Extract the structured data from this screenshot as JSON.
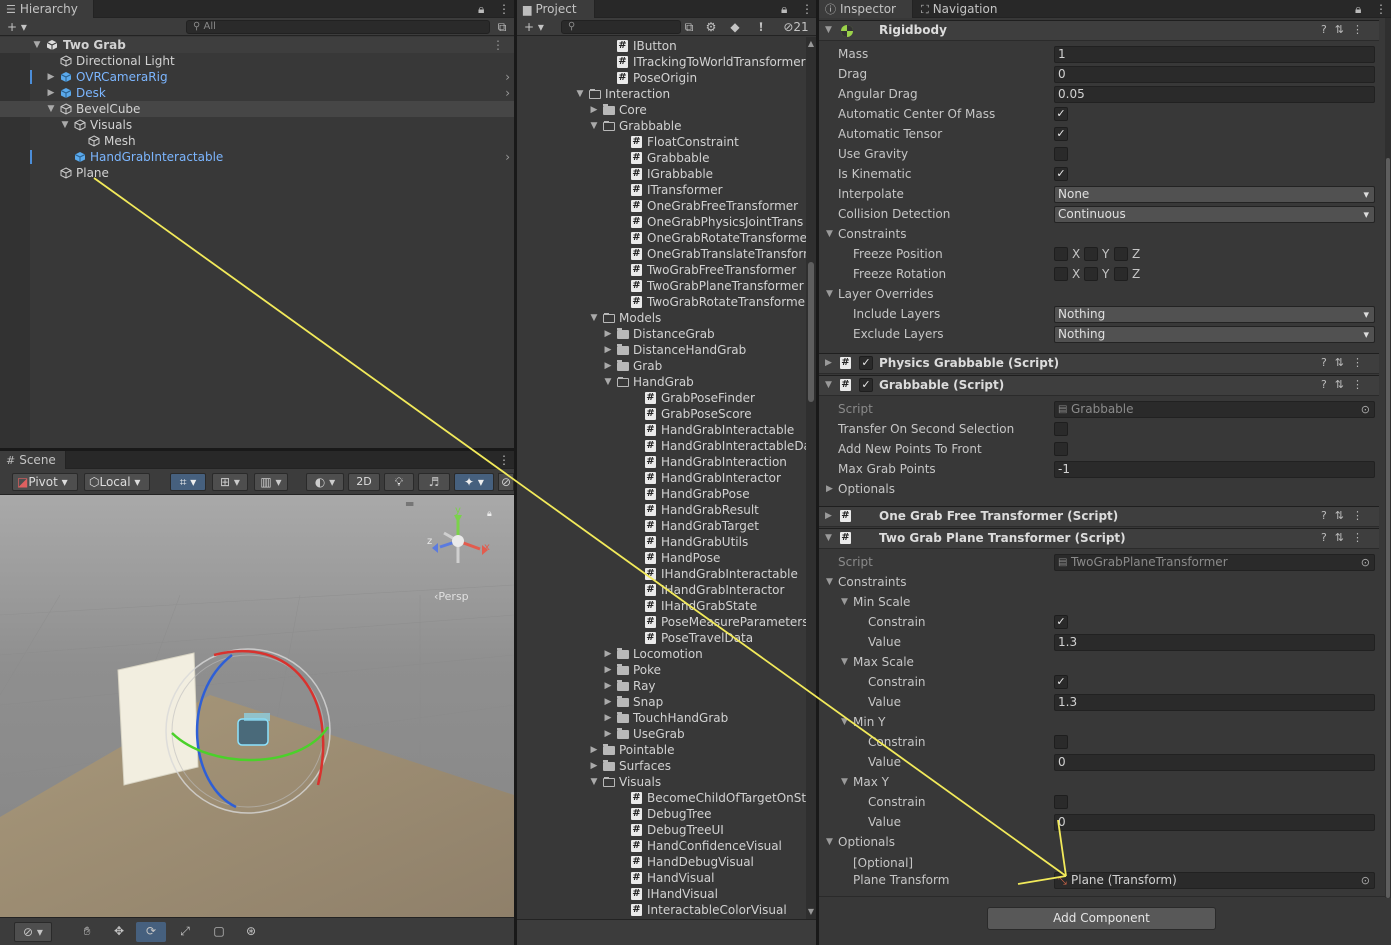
{
  "hierarchy": {
    "tab": "Hierarchy",
    "search_placeholder": "All",
    "rows": [
      {
        "label": "Two Grab",
        "kind": "root"
      },
      {
        "label": "Directional Light",
        "kind": "obj"
      },
      {
        "label": "OVRCameraRig",
        "kind": "prefab"
      },
      {
        "label": "Desk",
        "kind": "prefab"
      },
      {
        "label": "BevelCube",
        "kind": "obj"
      },
      {
        "label": "Visuals",
        "kind": "obj"
      },
      {
        "label": "Mesh",
        "kind": "obj"
      },
      {
        "label": "HandGrabInteractable",
        "kind": "prefab"
      },
      {
        "label": "Plane",
        "kind": "obj"
      }
    ]
  },
  "project": {
    "tab": "Project",
    "hidden_count": "21",
    "rows": [
      "IButton",
      "ITrackingToWorldTransformer",
      "PoseOrigin",
      "Interaction",
      "Core",
      "Grabbable",
      "FloatConstraint",
      "Grabbable",
      "IGrabbable",
      "ITransformer",
      "OneGrabFreeTransformer",
      "OneGrabPhysicsJointTrans",
      "OneGrabRotateTransformer",
      "OneGrabTranslateTransforn",
      "TwoGrabFreeTransformer",
      "TwoGrabPlaneTransformer",
      "TwoGrabRotateTransformer",
      "Models",
      "DistanceGrab",
      "DistanceHandGrab",
      "Grab",
      "HandGrab",
      "GrabPoseFinder",
      "GrabPoseScore",
      "HandGrabInteractable",
      "HandGrabInteractableDa",
      "HandGrabInteraction",
      "HandGrabInteractor",
      "HandGrabPose",
      "HandGrabResult",
      "HandGrabTarget",
      "HandGrabUtils",
      "HandPose",
      "IHandGrabInteractable",
      "IHandGrabInteractor",
      "IHandGrabState",
      "PoseMeasureParameters",
      "PoseTravelData",
      "Locomotion",
      "Poke",
      "Ray",
      "Snap",
      "TouchHandGrab",
      "UseGrab",
      "Pointable",
      "Surfaces",
      "Visuals",
      "BecomeChildOfTargetOnSt",
      "DebugTree",
      "DebugTreeUI",
      "HandConfidenceVisual",
      "HandDebugVisual",
      "HandVisual",
      "IHandVisual",
      "InteractableColorVisual"
    ]
  },
  "scene": {
    "tab": "Scene",
    "pivot": "Pivot",
    "local": "Local",
    "mode2d": "2D",
    "persp": "Persp",
    "axis_x": "x",
    "axis_y": "y",
    "axis_z": "z"
  },
  "inspector": {
    "tab_inspector": "Inspector",
    "tab_navigation": "Navigation",
    "rigidbody": {
      "title": "Rigidbody",
      "mass_label": "Mass",
      "mass": "1",
      "drag_label": "Drag",
      "drag": "0",
      "angular_drag_label": "Angular Drag",
      "angular_drag": "0.05",
      "auto_com_label": "Automatic Center Of Mass",
      "auto_tensor_label": "Automatic Tensor",
      "use_gravity_label": "Use Gravity",
      "is_kinematic_label": "Is Kinematic",
      "interpolate_label": "Interpolate",
      "interpolate": "None",
      "collision_label": "Collision Detection",
      "collision": "Continuous",
      "constraints_label": "Constraints",
      "freeze_pos_label": "Freeze Position",
      "freeze_rot_label": "Freeze Rotation",
      "x": "X",
      "y": "Y",
      "z": "Z",
      "layer_overrides_label": "Layer Overrides",
      "include_label": "Include Layers",
      "include": "Nothing",
      "exclude_label": "Exclude Layers",
      "exclude": "Nothing"
    },
    "physics_grabbable": {
      "title": "Physics Grabbable (Script)"
    },
    "grabbable": {
      "title": "Grabbable (Script)",
      "script_label": "Script",
      "script": "Grabbable",
      "transfer_label": "Transfer On Second Selection",
      "add_front_label": "Add New Points To Front",
      "max_points_label": "Max Grab Points",
      "max_points": "-1",
      "optionals_label": "Optionals"
    },
    "one_grab_free": {
      "title": "One Grab Free Transformer (Script)"
    },
    "two_grab_plane": {
      "title": "Two Grab Plane Transformer (Script)",
      "script_label": "Script",
      "script": "TwoGrabPlaneTransformer",
      "constraints_label": "Constraints",
      "min_scale_label": "Min Scale",
      "constrain_label": "Constrain",
      "value_label": "Value",
      "min_scale_value": "1.3",
      "max_scale_label": "Max Scale",
      "max_scale_value": "1.3",
      "min_y_label": "Min Y",
      "min_y_value": "0",
      "max_y_label": "Max Y",
      "max_y_value": "0",
      "optionals_label": "Optionals",
      "optional_tag": "[Optional]",
      "plane_transform_label": "Plane Transform",
      "plane_transform": "Plane (Transform)"
    },
    "add_component": "Add Component"
  }
}
